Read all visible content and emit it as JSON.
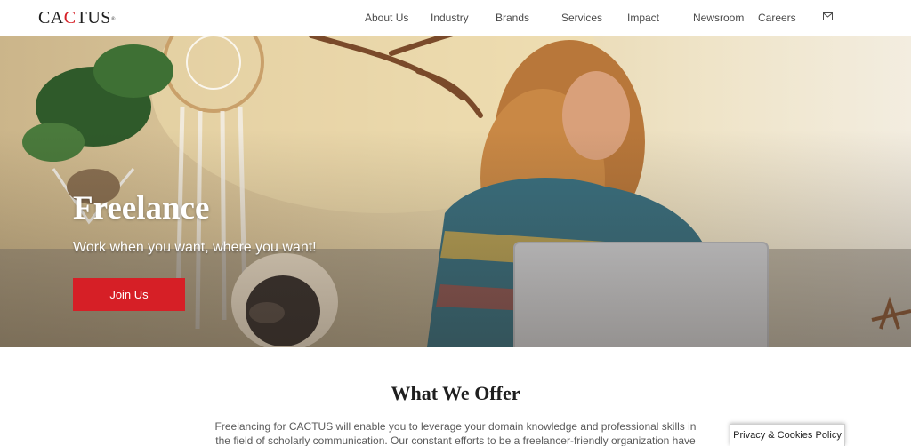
{
  "header": {
    "logo": {
      "part1": "CA",
      "accent": "C",
      "part2": "TUS",
      "mark": "®"
    },
    "nav": [
      "About Us",
      "Industry",
      "Brands",
      "Services",
      "Impact",
      "Newsroom",
      "Careers"
    ],
    "mail_icon": "envelope-icon"
  },
  "hero": {
    "title": "Freelance",
    "subtitle": "Work when you want, where you want!",
    "cta_label": "Join Us"
  },
  "offer": {
    "title": "What We Offer",
    "text": "Freelancing for CACTUS will enable you to leverage your domain knowledge and professional skills in the field of scholarly communication. Our constant efforts to be a freelancer-friendly organization have earned us a"
  },
  "cookie_tab": {
    "label": "Privacy & Cookies Policy"
  },
  "colors": {
    "accent": "#d61f26",
    "text_dark": "#1f1f1f",
    "nav_text": "#4a4a4a"
  }
}
